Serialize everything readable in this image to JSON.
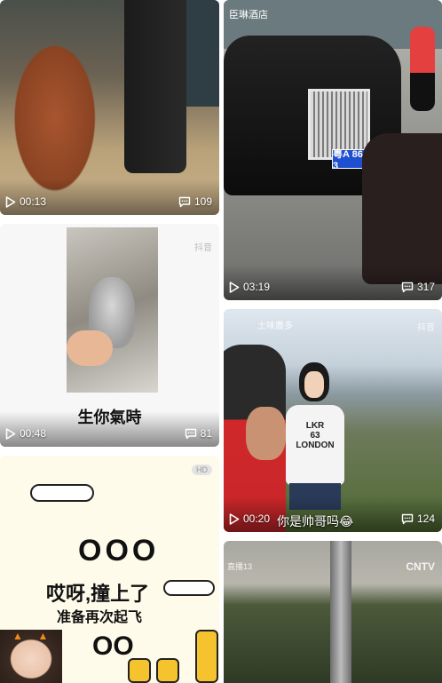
{
  "videos": [
    {
      "duration": "00:13",
      "comments": "109"
    },
    {
      "duration": "03:19",
      "comments": "317",
      "plate": "粤A 8691 3",
      "sign": "臣琳酒店"
    },
    {
      "duration": "00:48",
      "comments": "81",
      "caption": "生你氣時",
      "watermark": "抖音"
    },
    {
      "duration": "00:20",
      "comments": "124",
      "subtitle": "你是帅哥吗😂",
      "logo": "土味農多",
      "watermark": "抖音",
      "shirt_text": "LKR\n63\nLONDON"
    },
    {
      "hd_badge": "HD",
      "ooo": "OOO",
      "line1": "哎呀,撞上了",
      "line2": "准备再次起飞",
      "oo": "OO"
    },
    {
      "cctv": "CNTV",
      "tag": "直播13"
    }
  ],
  "icons": {
    "play": "play-icon",
    "comment": "comment-icon"
  }
}
